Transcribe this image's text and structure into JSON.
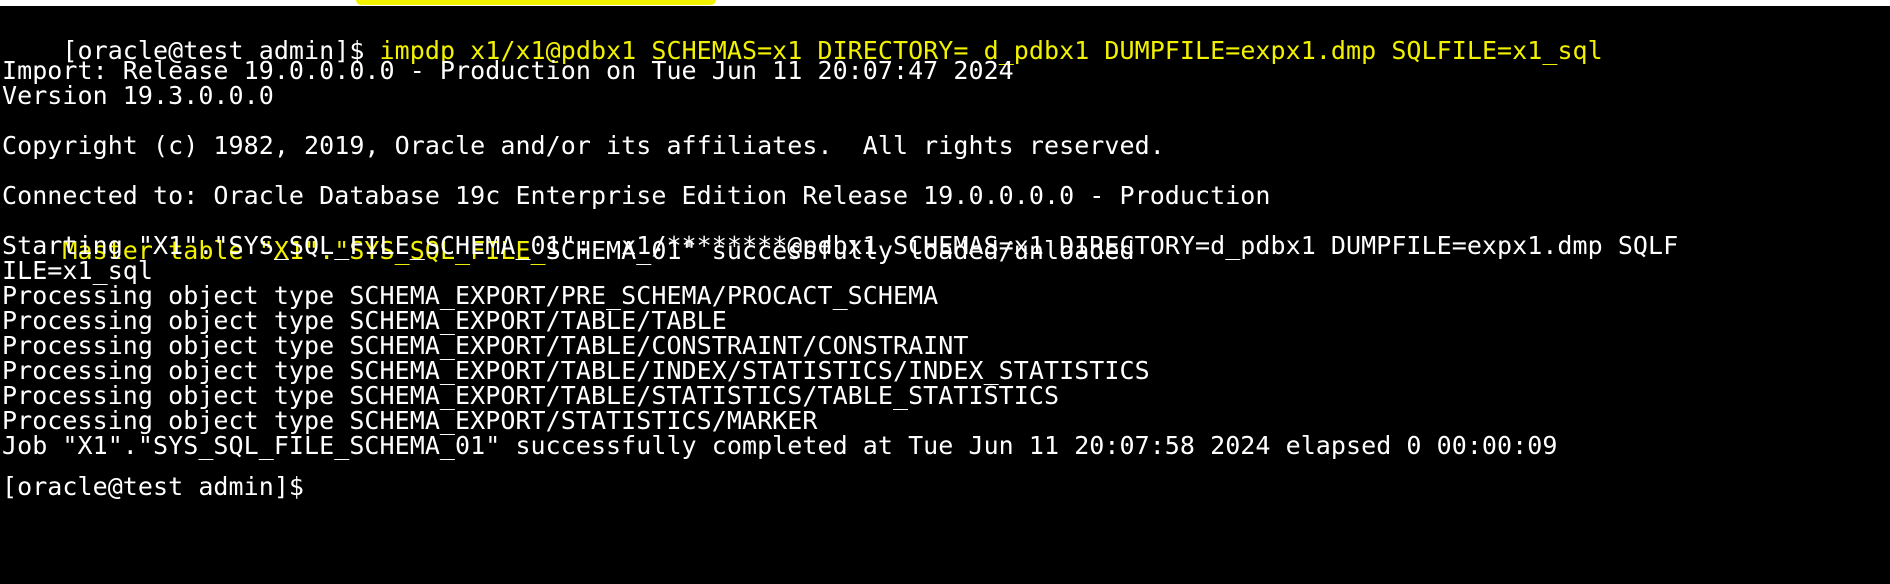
{
  "terminal": {
    "colors": {
      "background": "#000000",
      "text": "#ffffff",
      "highlight": "#f2f200"
    },
    "prompt": "[oracle@test admin]$ ",
    "command": "impdp x1/x1@pdbx1 SCHEMAS=x1 DIRECTORY= d_pdbx1 DUMPFILE=expx1.dmp SQLFILE=x1_sql",
    "import_line": "Import: Release 19.0.0.0.0 - Production on Tue Jun 11 20:07:47 2024",
    "version_line": "Version 19.3.0.0.0",
    "copyright_line": "Copyright (c) 1982, 2019, Oracle and/or its affiliates.  All rights reserved.",
    "connected_line": "Connected to: Oracle Database 19c Enterprise Edition Release 19.0.0.0.0 - Production",
    "master_table_highlighted": "Master table \"X1\".\"SYS_SQL_FILE_",
    "master_table_rest": "SCHEMA_01\" successfully loaded/unloaded",
    "starting_line_1": "Starting \"X1\".\"SYS_SQL_FILE_SCHEMA_01\":  x1/********@pdbx1 SCHEMAS=x1 DIRECTORY=d_pdbx1 DUMPFILE=expx1.dmp SQLF",
    "starting_line_2": "ILE=x1_sql",
    "processing_lines": [
      "Processing object type SCHEMA_EXPORT/PRE_SCHEMA/PROCACT_SCHEMA",
      "Processing object type SCHEMA_EXPORT/TABLE/TABLE",
      "Processing object type SCHEMA_EXPORT/TABLE/CONSTRAINT/CONSTRAINT",
      "Processing object type SCHEMA_EXPORT/TABLE/INDEX/STATISTICS/INDEX_STATISTICS",
      "Processing object type SCHEMA_EXPORT/TABLE/STATISTICS/TABLE_STATISTICS",
      "Processing object type SCHEMA_EXPORT/STATISTICS/MARKER"
    ],
    "job_line": "Job \"X1\".\"SYS_SQL_FILE_SCHEMA_01\" successfully completed at Tue Jun 11 20:07:58 2024 elapsed 0 00:00:09",
    "next_prompt": "[oracle@test admin]$"
  }
}
